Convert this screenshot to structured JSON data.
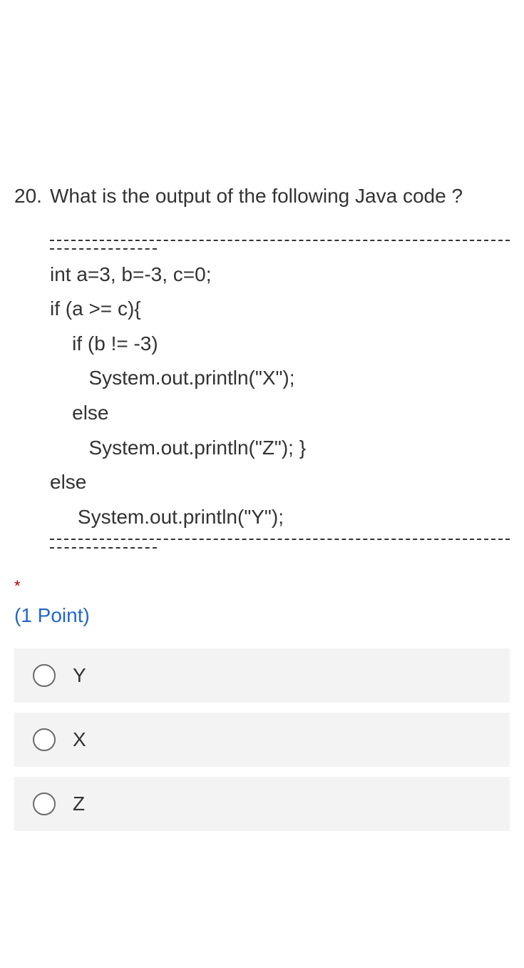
{
  "question": {
    "number": "20.",
    "text": "What is the output of the following Java code ?",
    "code_lines": [
      "int a=3, b=-3, c=0;",
      "if (a >= c){",
      "    if (b != -3)",
      "       System.out.println(\"X\");",
      "    else",
      "       System.out.println(\"Z\"); }",
      "else",
      "     System.out.println(\"Y\");"
    ],
    "required_mark": "*",
    "points": "(1 Point)"
  },
  "options": [
    {
      "label": "Y"
    },
    {
      "label": "X"
    },
    {
      "label": "Z"
    }
  ]
}
